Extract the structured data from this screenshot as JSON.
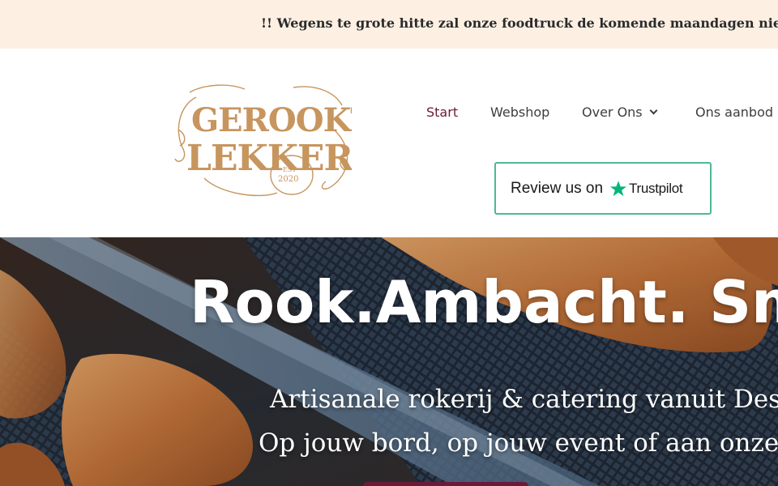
{
  "announcement": {
    "text": "!! Wegens te grote hitte zal onze foodtruck de komende maandagen niet in Heusden staan !!"
  },
  "logo": {
    "line1": "GEROOKT",
    "line2": "LEKKERS",
    "est": "EST",
    "year": "2020"
  },
  "nav": {
    "items": [
      {
        "label": "Start",
        "active": true
      },
      {
        "label": "Webshop"
      },
      {
        "label": "Over Ons",
        "has_dropdown": true
      },
      {
        "label": "Ons aanbod"
      }
    ]
  },
  "trustpilot": {
    "label": "Review us on",
    "brand": "Trustpilot",
    "color": "#00b67a"
  },
  "hero": {
    "title": "Rook.Ambacht. Smaak.",
    "line1": "Artisanale rokerij & catering vanuit Destelbergen",
    "line2": "Op jouw bord, op jouw event of aan onze foodtruck"
  },
  "colors": {
    "announce_bg": "#fdf0e3",
    "accent": "#6b1a3a",
    "logo_gold": "#c7955e",
    "trustpilot_border": "#4fb894"
  }
}
